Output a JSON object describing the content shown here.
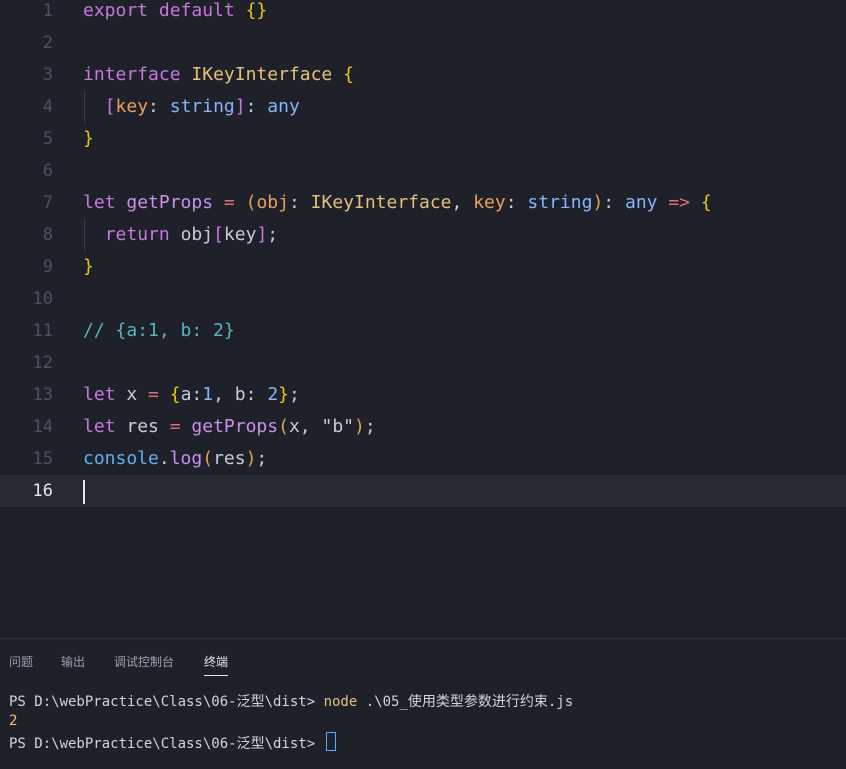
{
  "editor": {
    "lines": [
      {
        "num": "1",
        "tokens": [
          [
            "kw2",
            "export"
          ],
          [
            "str",
            " "
          ],
          [
            "kw2",
            "default"
          ],
          [
            "str",
            " "
          ],
          [
            "brace",
            "{}"
          ]
        ]
      },
      {
        "num": "2",
        "tokens": []
      },
      {
        "num": "3",
        "tokens": [
          [
            "kw2",
            "interface"
          ],
          [
            "str",
            " "
          ],
          [
            "type",
            "IKeyInterface"
          ],
          [
            "str",
            " "
          ],
          [
            "brace",
            "{"
          ]
        ]
      },
      {
        "num": "4",
        "tokens": [
          [
            "str",
            "  "
          ],
          [
            "bracket",
            "["
          ],
          [
            "prop",
            "key"
          ],
          [
            "str",
            ": "
          ],
          [
            "ptype",
            "string"
          ],
          [
            "bracket",
            "]"
          ],
          [
            "str",
            ": "
          ],
          [
            "ptype",
            "any"
          ]
        ]
      },
      {
        "num": "5",
        "tokens": [
          [
            "brace",
            "}"
          ]
        ]
      },
      {
        "num": "6",
        "tokens": []
      },
      {
        "num": "7",
        "tokens": [
          [
            "kw2",
            "let"
          ],
          [
            "str",
            " "
          ],
          [
            "fn",
            "getProps"
          ],
          [
            "str",
            " "
          ],
          [
            "arrow",
            "="
          ],
          [
            "str",
            " "
          ],
          [
            "paren",
            "("
          ],
          [
            "prop",
            "obj"
          ],
          [
            "str",
            ": "
          ],
          [
            "type",
            "IKeyInterface"
          ],
          [
            "str",
            ", "
          ],
          [
            "prop",
            "key"
          ],
          [
            "str",
            ": "
          ],
          [
            "ptype",
            "string"
          ],
          [
            "paren",
            ")"
          ],
          [
            "str",
            ": "
          ],
          [
            "ptype",
            "any"
          ],
          [
            "str",
            " "
          ],
          [
            "arrow",
            "=>"
          ],
          [
            "str",
            " "
          ],
          [
            "brace",
            "{"
          ]
        ]
      },
      {
        "num": "8",
        "tokens": [
          [
            "str",
            "  "
          ],
          [
            "kw2",
            "return"
          ],
          [
            "str",
            " "
          ],
          [
            "var",
            "obj"
          ],
          [
            "bracket",
            "["
          ],
          [
            "var",
            "key"
          ],
          [
            "bracket",
            "]"
          ],
          [
            "str",
            ";"
          ]
        ]
      },
      {
        "num": "9",
        "tokens": [
          [
            "brace",
            "}"
          ]
        ]
      },
      {
        "num": "10",
        "tokens": []
      },
      {
        "num": "11",
        "tokens": [
          [
            "cmt",
            "// {a:1, b: 2}"
          ]
        ]
      },
      {
        "num": "12",
        "tokens": []
      },
      {
        "num": "13",
        "tokens": [
          [
            "kw2",
            "let"
          ],
          [
            "str",
            " "
          ],
          [
            "var",
            "x"
          ],
          [
            "str",
            " "
          ],
          [
            "arrow",
            "="
          ],
          [
            "str",
            " "
          ],
          [
            "brace",
            "{"
          ],
          [
            "var",
            "a"
          ],
          [
            "str",
            ":"
          ],
          [
            "num",
            "1"
          ],
          [
            "str",
            ", "
          ],
          [
            "var",
            "b"
          ],
          [
            "str",
            ": "
          ],
          [
            "num",
            "2"
          ],
          [
            "brace",
            "}"
          ],
          [
            "str",
            ";"
          ]
        ]
      },
      {
        "num": "14",
        "tokens": [
          [
            "kw2",
            "let"
          ],
          [
            "str",
            " "
          ],
          [
            "var",
            "res"
          ],
          [
            "str",
            " "
          ],
          [
            "arrow",
            "="
          ],
          [
            "str",
            " "
          ],
          [
            "fn",
            "getProps"
          ],
          [
            "paren",
            "("
          ],
          [
            "var",
            "x"
          ],
          [
            "str",
            ", "
          ],
          [
            "str",
            "\"b\""
          ],
          [
            "paren",
            ")"
          ],
          [
            "str",
            ";"
          ]
        ]
      },
      {
        "num": "15",
        "tokens": [
          [
            "builtin",
            "console"
          ],
          [
            "str",
            "."
          ],
          [
            "fn",
            "log"
          ],
          [
            "paren",
            "("
          ],
          [
            "var",
            "res"
          ],
          [
            "paren",
            ")"
          ],
          [
            "str",
            ";"
          ]
        ]
      },
      {
        "num": "16",
        "tokens": []
      }
    ]
  },
  "panel": {
    "tabs": [
      {
        "label": "问题",
        "active": false
      },
      {
        "label": "输出",
        "active": false
      },
      {
        "label": "调试控制台",
        "active": false
      },
      {
        "label": "终端",
        "active": true
      }
    ],
    "terminal": {
      "line1_prompt": "PS D:\\webPractice\\Class\\06-泛型\\dist> ",
      "line1_cmd": "node",
      "line1_args": " .\\05_使用类型参数进行约束.js",
      "line2_output": "2",
      "line3_prompt": "PS D:\\webPractice\\Class\\06-泛型\\dist> "
    }
  }
}
